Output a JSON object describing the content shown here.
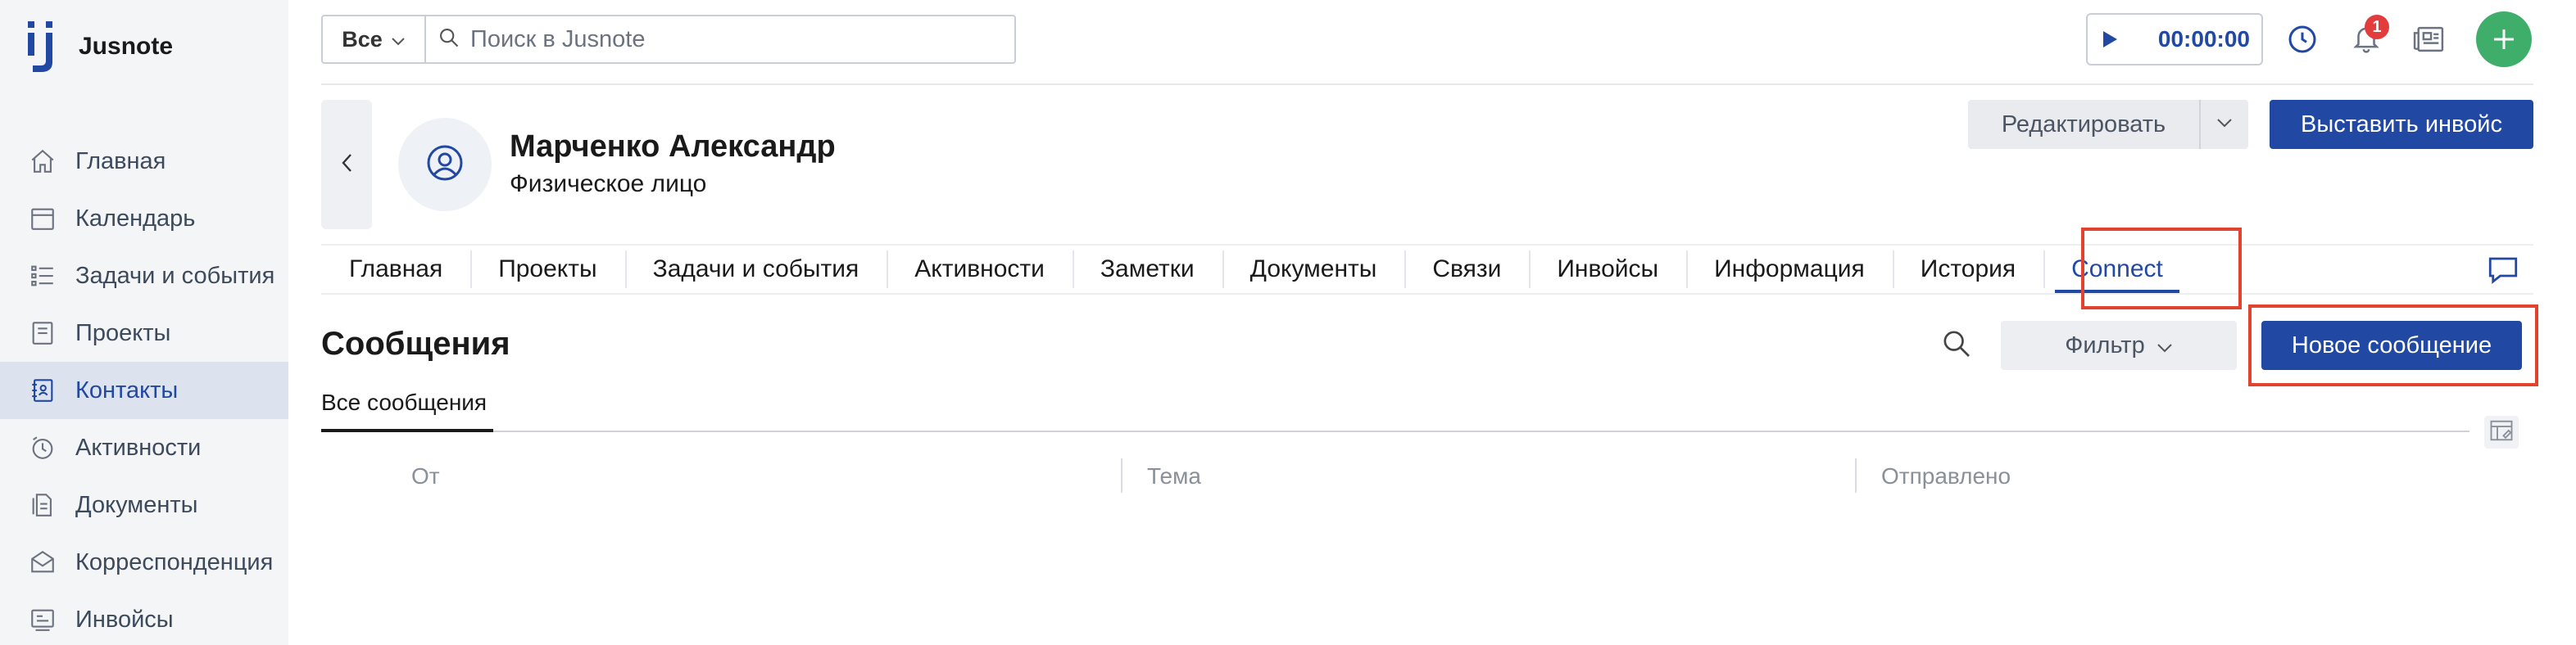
{
  "app": {
    "name": "Jusnote"
  },
  "sidebar": {
    "items": [
      {
        "label": "Главная",
        "icon": "home-icon",
        "active": false
      },
      {
        "label": "Календарь",
        "icon": "calendar-icon",
        "active": false
      },
      {
        "label": "Задачи и события",
        "icon": "tasks-icon",
        "active": false
      },
      {
        "label": "Проекты",
        "icon": "projects-icon",
        "active": false
      },
      {
        "label": "Контакты",
        "icon": "contacts-icon",
        "active": true
      },
      {
        "label": "Активности",
        "icon": "activity-icon",
        "active": false
      },
      {
        "label": "Документы",
        "icon": "documents-icon",
        "active": false
      },
      {
        "label": "Корреспонденция",
        "icon": "correspondence-icon",
        "active": false
      },
      {
        "label": "Инвойсы",
        "icon": "invoices-icon",
        "active": false
      }
    ]
  },
  "topbar": {
    "scope": "Все",
    "search_placeholder": "Поиск в Jusnote",
    "timer": "00:00:00",
    "notifications_count": "1"
  },
  "contact": {
    "name": "Марченко Александр",
    "type": "Физическое лицо",
    "edit_label": "Редактировать",
    "invoice_label": "Выставить инвойс"
  },
  "tabs": [
    {
      "label": "Главная",
      "active": false
    },
    {
      "label": "Проекты",
      "active": false
    },
    {
      "label": "Задачи и события",
      "active": false
    },
    {
      "label": "Активности",
      "active": false
    },
    {
      "label": "Заметки",
      "active": false
    },
    {
      "label": "Документы",
      "active": false
    },
    {
      "label": "Связи",
      "active": false
    },
    {
      "label": "Инвойсы",
      "active": false
    },
    {
      "label": "Информация",
      "active": false
    },
    {
      "label": "История",
      "active": false
    },
    {
      "label": "Connect",
      "active": true
    }
  ],
  "messages": {
    "title": "Сообщения",
    "filter_label": "Фильтр",
    "new_label": "Новое сообщение",
    "subtab": "Все сообщения",
    "columns": [
      "От",
      "Тема",
      "Отправлено"
    ]
  },
  "colors": {
    "accent": "#2148a3",
    "highlight": "#e2432e",
    "add": "#3fae6a",
    "badge": "#e23c3c"
  }
}
